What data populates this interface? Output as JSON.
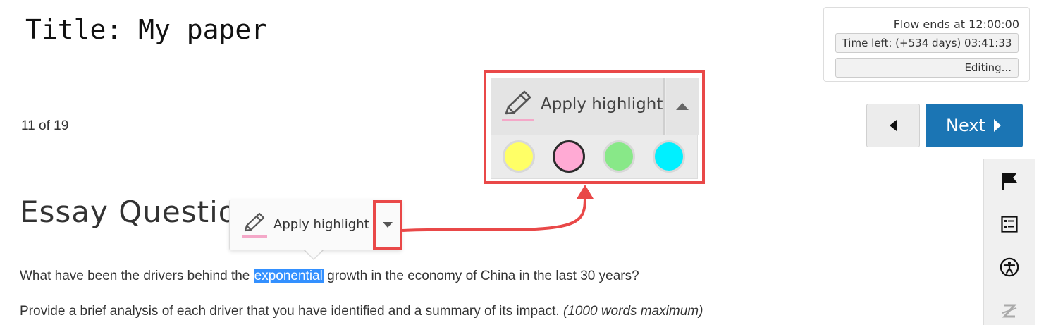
{
  "header": {
    "title": "Title: My paper"
  },
  "timer": {
    "flow_ends": "Flow ends at 12:00:00",
    "time_left": "Time left: (+534 days) 03:41:33",
    "editing": "Editing..."
  },
  "navigation": {
    "progress": "11 of 19",
    "next_label": "Next"
  },
  "question": {
    "heading": "Essay Question",
    "text_before": "What have been the drivers behind the ",
    "highlighted": "exponential",
    "text_after": " growth in the economy of China in the last 30 years?",
    "instruction": "Provide a brief analysis of each driver that you have identified and a summary of its impact. ",
    "instruction_note": "(1000 words maximum)"
  },
  "highlight_popup": {
    "label": "Apply highlight"
  },
  "highlight_panel": {
    "label": "Apply highlight",
    "swatches": [
      {
        "name": "yellow",
        "color": "#ffff66",
        "selected": false
      },
      {
        "name": "pink",
        "color": "#ffaad4",
        "selected": true
      },
      {
        "name": "green",
        "color": "#88e888",
        "selected": false
      },
      {
        "name": "cyan",
        "color": "#00f0ff",
        "selected": false
      }
    ]
  },
  "colors": {
    "accent": "#1b75b4",
    "annotation": "#e94848",
    "selection": "#3390ff",
    "pencil_underline": "#f4a8c8"
  },
  "side_toolbar": {
    "icons": [
      "flag-icon",
      "list-icon",
      "accessibility-icon",
      "strikethrough-z-icon"
    ]
  }
}
